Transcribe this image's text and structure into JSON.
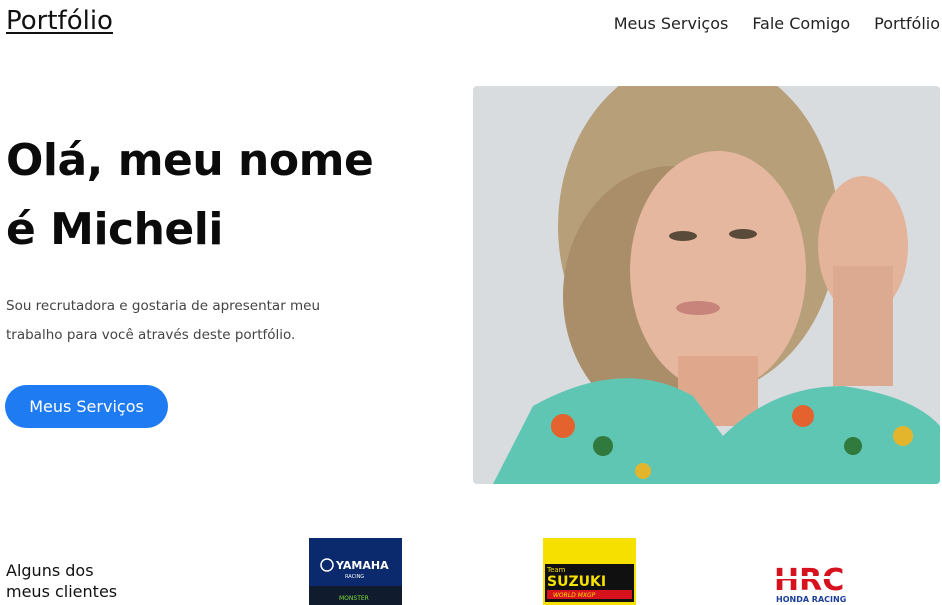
{
  "header": {
    "logo": "Portfólio",
    "nav": [
      "Meus Serviços",
      "Fale Comigo",
      "Portfólio"
    ]
  },
  "hero": {
    "title_line1": "Olá, meu nome",
    "title_line2": "é Micheli",
    "text_line1": "Sou recrutadora e gostaria de apresentar meu",
    "text_line2": "trabalho para você através deste portfólio.",
    "cta_label": "Meus Serviços"
  },
  "clients": {
    "title_line1": "Alguns dos",
    "title_line2": "meus clientes",
    "logos": [
      {
        "name": "yamaha",
        "text1": "YAMAHA",
        "text2": "RACING",
        "text3": "MONSTER"
      },
      {
        "name": "suzuki",
        "text1": "Team",
        "text2": "SUZUKI",
        "text3": "WORLD MXGP"
      },
      {
        "name": "hrc",
        "text1": "HRC",
        "text2": "HONDA RACING"
      }
    ]
  },
  "colors": {
    "accent": "#1f7bf2",
    "yamaha_bg": "#0b2a6d",
    "suzuki_bg": "#f6e000",
    "hrc_red": "#d6121e",
    "hrc_blue": "#1b3f9a"
  }
}
